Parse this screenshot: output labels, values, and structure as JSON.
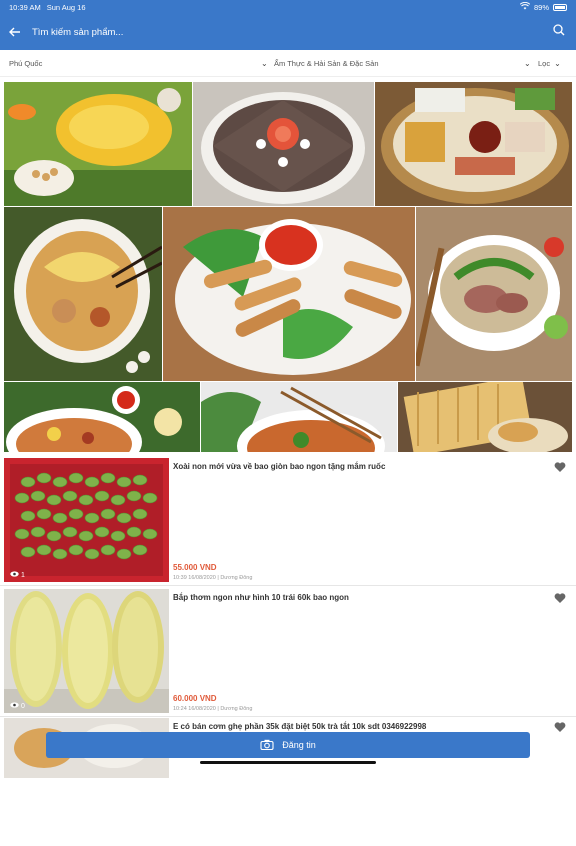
{
  "status": {
    "time": "10:39 AM",
    "date": "Sun Aug 16",
    "battery": "89%"
  },
  "search": {
    "placeholder": "Tìm kiếm sản phẩm..."
  },
  "filters": {
    "location": "Phú Quốc",
    "category": "Ẩm Thực & Hải Sản & Đặc Sản",
    "filter": "Lọc"
  },
  "listings": [
    {
      "title": "Xoài non mới vừa về bao giòn bao ngon tặng mắm ruốc",
      "price": "55.000 VND",
      "meta_time": "10:39 16/08/2020",
      "meta_author": "Dương Đông",
      "views": "1"
    },
    {
      "title": "Bắp thơm ngon như hình  10 trái  60k bao ngon",
      "price": "60.000 VND",
      "meta_time": "10:24 16/08/2020",
      "meta_author": "Dương Đông",
      "views": "0"
    },
    {
      "title": "E có bán cơm ghẹ  phần 35k đặt biệt 50k trà tắt 10k sdt 0346922998"
    }
  ],
  "post_button": {
    "label": "Đăng tin"
  },
  "icons": {
    "back": "arrow-left-icon",
    "search": "search-icon",
    "heart": "heart-icon",
    "eye": "eye-icon",
    "camera": "camera-icon",
    "wifi": "wifi-icon",
    "battery": "battery-icon"
  },
  "colors": {
    "primary": "#3a78c9",
    "price": "#e05a3a"
  }
}
